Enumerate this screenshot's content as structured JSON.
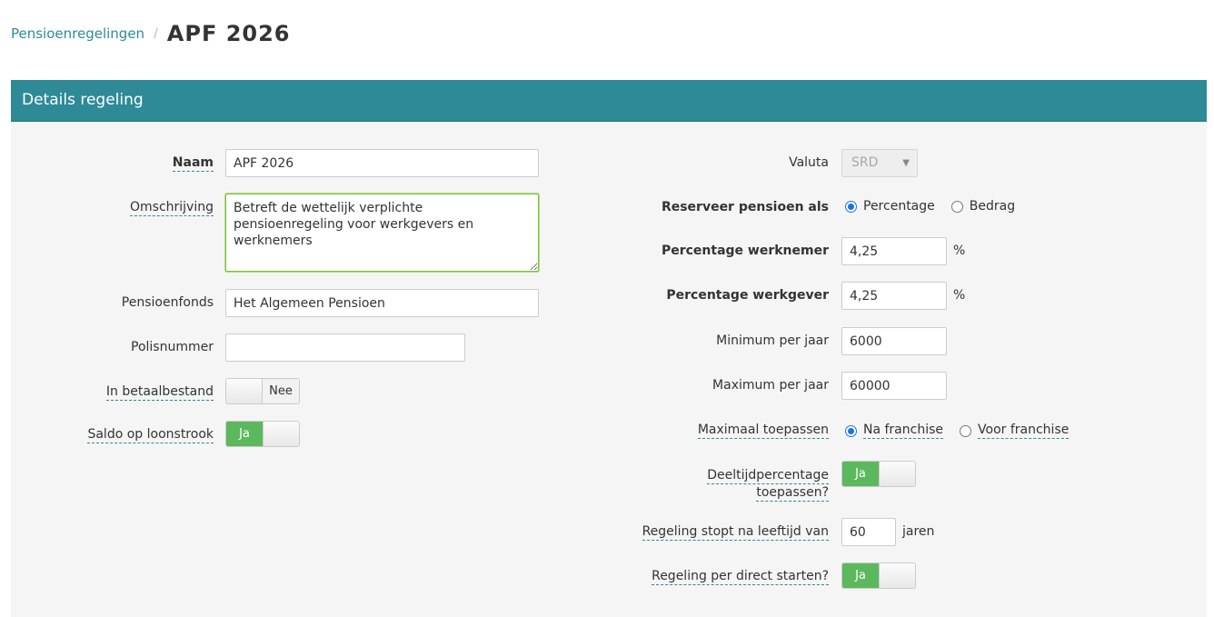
{
  "breadcrumb": {
    "parent": "Pensioenregelingen",
    "separator": "/",
    "current": "APF 2026"
  },
  "panel": {
    "title": "Details regeling"
  },
  "left": {
    "naam_label": "Naam",
    "naam_value": "APF 2026",
    "omschrijving_label": "Omschrijving",
    "omschrijving_value": "Betreft de wettelijk verplichte pensioenregeling voor werkgevers en werknemers",
    "pensioenfonds_label": "Pensioenfonds",
    "pensioenfonds_value": "Het Algemeen Pensioen",
    "polisnummer_label": "Polisnummer",
    "polisnummer_value": "",
    "betaalbestand_label": "In betaalbestand",
    "betaalbestand_value": "Nee",
    "saldo_label": "Saldo op loonstrook",
    "saldo_value": "Ja"
  },
  "right": {
    "valuta_label": "Valuta",
    "valuta_value": "SRD",
    "reserveer_label": "Reserveer pensioen als",
    "reserveer_options": [
      "Percentage",
      "Bedrag"
    ],
    "reserveer_selected": "Percentage",
    "perc_werknemer_label": "Percentage werknemer",
    "perc_werknemer_value": "4,25",
    "perc_werkgever_label": "Percentage werkgever",
    "perc_werkgever_value": "4,25",
    "percent_unit": "%",
    "minimum_label": "Minimum per jaar",
    "minimum_value": "6000",
    "maximum_label": "Maximum per jaar",
    "maximum_value": "60000",
    "max_toepassen_label": "Maximaal toepassen",
    "max_toepassen_options": [
      "Na franchise",
      "Voor franchise"
    ],
    "max_toepassen_selected": "Na franchise",
    "deeltijd_label_1": "Deeltijdpercentage",
    "deeltijd_label_2": "toepassen?",
    "deeltijd_value": "Ja",
    "stopt_label": "Regeling stopt na leeftijd van",
    "stopt_value": "60",
    "stopt_unit": "jaren",
    "direct_label": "Regeling per direct starten?",
    "direct_value": "Ja"
  },
  "colors": {
    "accent": "#2e8a97",
    "toggle_on": "#5cb85c",
    "radio": "#1a73e8"
  }
}
